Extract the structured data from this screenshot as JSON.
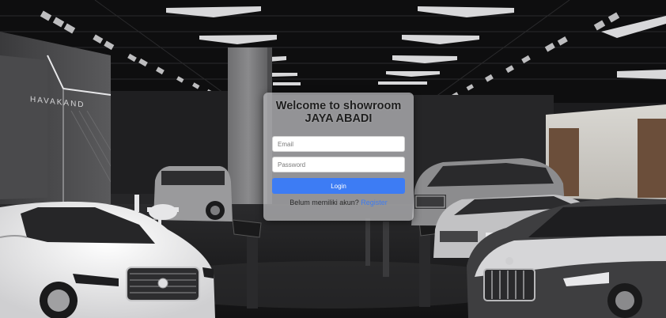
{
  "login": {
    "title_line1": "Welcome to showroom",
    "title_line2": "JAYA ABADI",
    "email_placeholder": "Email",
    "password_placeholder": "Password",
    "login_label": "Login",
    "register_prompt": "Belum memiliki akun?",
    "register_link": "Register"
  },
  "background": {
    "wall_sign": "HAVAKAND"
  },
  "colors": {
    "card_bg": "#bebec0",
    "button": "#3d7cf4",
    "link": "#3f7cf0",
    "title": "#1e1e1e"
  }
}
